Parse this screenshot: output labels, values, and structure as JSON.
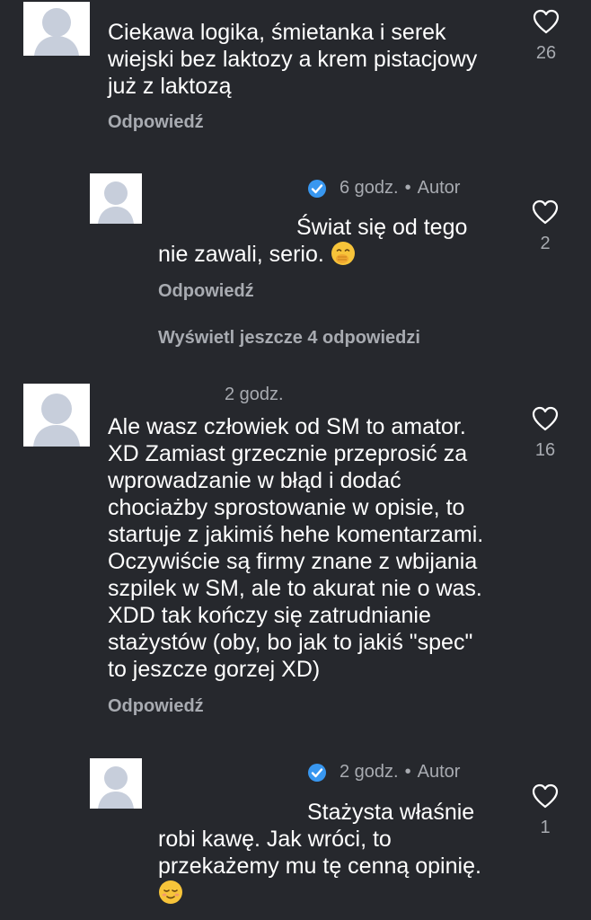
{
  "comments": [
    {
      "text_lines": [
        "Ciekawa logika, śmietanka i serek",
        "wiejski bez laktozy a krem pistacjowy",
        "już z laktozą"
      ],
      "reply_label": "Odpowiedź",
      "likes": "26"
    },
    {
      "time": "6 godz.",
      "separator": "•",
      "author_badge": "Autor",
      "text_lines": [
        "Świat się od tego",
        "nie zawali, serio."
      ],
      "emoji": "face-with-hand-over-mouth",
      "reply_label": "Odpowiedź",
      "likes": "2"
    },
    {
      "time": "2 godz.",
      "text_lines": [
        "Ale wasz człowiek od SM to amator.",
        "XD Zamiast grzecznie przeprosić za",
        "wprowadzanie w błąd i dodać",
        "chociażby sprostowanie w opisie, to",
        "startuje z jakimiś hehe komentarzami.",
        "Oczywiście są firmy znane z wbijania",
        "szpilek w SM, ale to akurat nie o was.",
        "XDD tak kończy się zatrudnianie",
        "stażystów (oby, bo jak to jakiś \"spec\"",
        "to jeszcze gorzej XD)"
      ],
      "reply_label": "Odpowiedź",
      "likes": "16"
    },
    {
      "time": "2 godz.",
      "separator": "•",
      "author_badge": "Autor",
      "text_lines": [
        "Stażysta właśnie",
        "robi kawę. Jak wróci, to",
        "przekażemy mu tę cenną opinię."
      ],
      "emoji": "relieved-face",
      "likes": "1"
    }
  ],
  "view_more_label": "Wyświetl jeszcze 4 odpowiedzi",
  "colors": {
    "background": "#26282d",
    "text": "#ffffff",
    "muted": "#a8abb1",
    "verified": "#3897f0",
    "emoji": "#f7c43a"
  }
}
